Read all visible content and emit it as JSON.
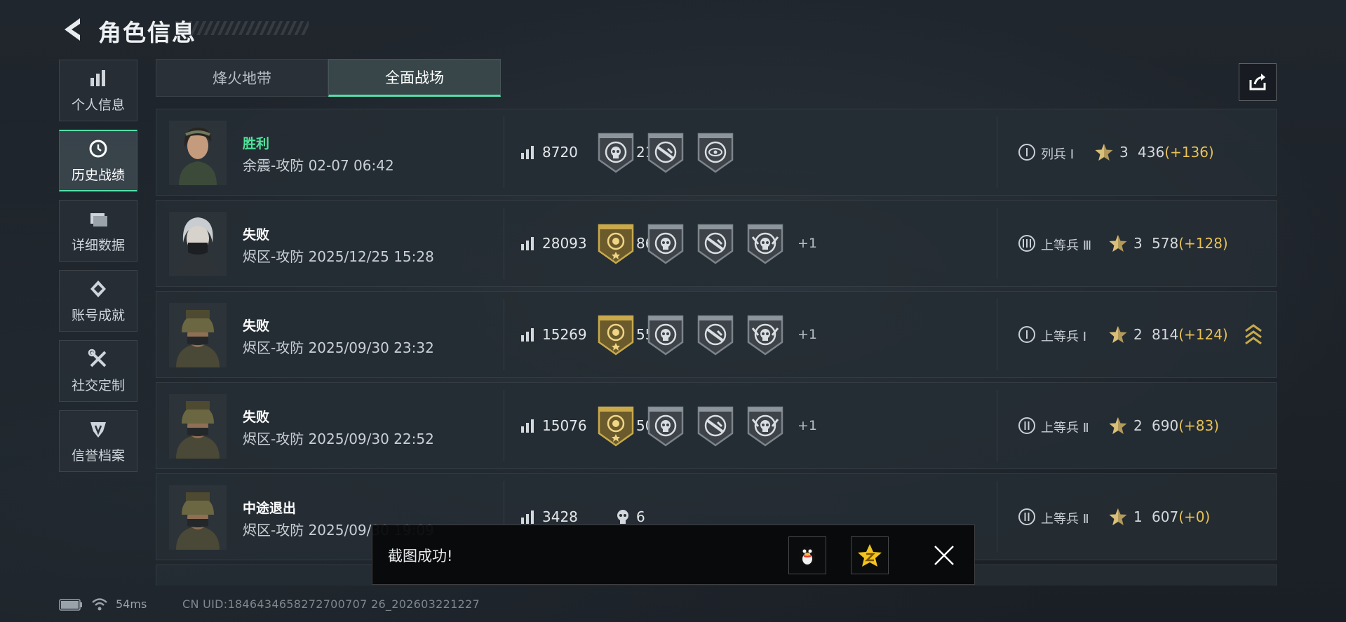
{
  "header": {
    "title": "角色信息",
    "back_icon": "back-arrow-icon"
  },
  "sidebar": {
    "items": [
      {
        "label": "个人信息",
        "icon": "bar-chart-icon",
        "active": false
      },
      {
        "label": "历史战绩",
        "icon": "clock-history-icon",
        "active": true
      },
      {
        "label": "详细数据",
        "icon": "folder-icon",
        "active": false
      },
      {
        "label": "账号成就",
        "icon": "achievement-icon",
        "active": false
      },
      {
        "label": "社交定制",
        "icon": "tools-icon",
        "active": false
      },
      {
        "label": "信誉档案",
        "icon": "credit-shield-icon",
        "active": false
      }
    ]
  },
  "tabs": [
    {
      "label": "烽火地带",
      "active": false
    },
    {
      "label": "全面战场",
      "active": true
    }
  ],
  "share": {
    "icon": "share-icon"
  },
  "matches": [
    {
      "result": "胜利",
      "win": true,
      "info": "余震-攻防 02-07 06:42",
      "score": "8720",
      "kills": "21",
      "medals": [
        "skull-target",
        "rifle-target",
        "eye-target"
      ],
      "more": "",
      "rank_numeral": "I",
      "rank_name": "列兵 Ⅰ",
      "stars": "3",
      "points": "436",
      "delta": "(+136)",
      "chevron": false,
      "avatar": "female-soldier"
    },
    {
      "result": "失败",
      "win": false,
      "info": "烬区-攻防 2025/12/25 15:28",
      "score": "28093",
      "kills": "86",
      "medals": [
        "gold-rose",
        "skull-target",
        "rifle-target",
        "skull-wings"
      ],
      "more": "+1",
      "rank_numeral": "III",
      "rank_name": "上等兵 Ⅲ",
      "stars": "3",
      "points": "578",
      "delta": "(+128)",
      "chevron": false,
      "avatar": "masked-silver"
    },
    {
      "result": "失败",
      "win": false,
      "info": "烬区-攻防 2025/09/30 23:32",
      "score": "15269",
      "kills": "55",
      "medals": [
        "gold-rose",
        "skull-target",
        "rifle-target",
        "skull-wings"
      ],
      "more": "+1",
      "rank_numeral": "I",
      "rank_name": "上等兵 Ⅰ",
      "stars": "2",
      "points": "814",
      "delta": "(+124)",
      "chevron": true,
      "avatar": "helmet-soldier"
    },
    {
      "result": "失败",
      "win": false,
      "info": "烬区-攻防 2025/09/30 22:52",
      "score": "15076",
      "kills": "50",
      "medals": [
        "gold-rose",
        "skull-target",
        "rifle-target",
        "skull-wings"
      ],
      "more": "+1",
      "rank_numeral": "II",
      "rank_name": "上等兵 Ⅱ",
      "stars": "2",
      "points": "690",
      "delta": "(+83)",
      "chevron": false,
      "avatar": "helmet-soldier"
    },
    {
      "result": "中途退出",
      "win": false,
      "info": "烬区-攻防 2025/09/30 19:09",
      "score": "3428",
      "kills": "6",
      "medals": [],
      "more": "",
      "rank_numeral": "II",
      "rank_name": "上等兵 Ⅱ",
      "stars": "1",
      "points": "607",
      "delta": "(+0)",
      "chevron": false,
      "avatar": "helmet-soldier"
    }
  ],
  "toast": {
    "text": "截图成功!",
    "qq_icon": "qq-penguin-icon",
    "qzone_icon": "qzone-star-icon",
    "close_icon": "close-icon"
  },
  "footer": {
    "ping": "54ms",
    "uid": "CN UID:1846434658272700707 26_202603221227"
  },
  "colors": {
    "accent": "#53e0a9",
    "win": "#4fe39a",
    "delta": "#e8c155",
    "gold_medal": "#c9a94a"
  }
}
